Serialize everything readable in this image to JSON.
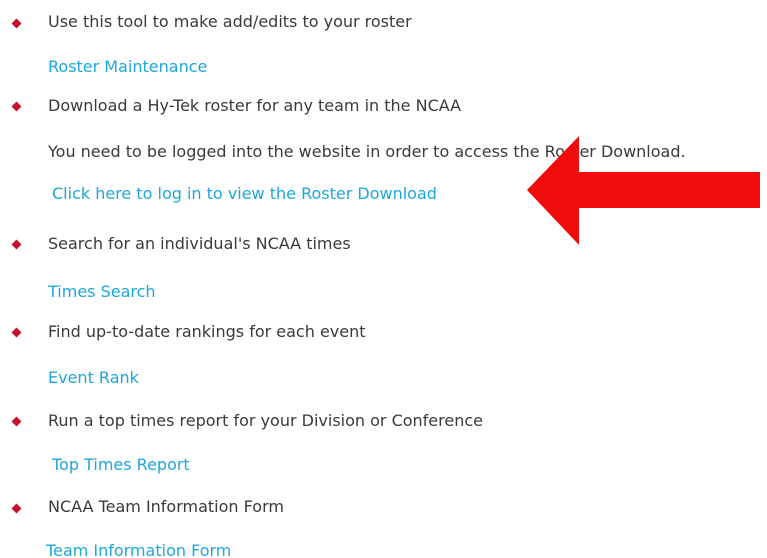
{
  "items": [
    {
      "text": "Use this tool to make add/edits to your roster",
      "link": "Roster Maintenance"
    },
    {
      "text": "Download a Hy-Tek roster for any team in the NCAA",
      "note": "You need to be logged into the website in order to access the Roster Download.",
      "link": "Click here to log in to view the Roster Download"
    },
    {
      "text": "Search for an individual's NCAA times",
      "link": "Times Search"
    },
    {
      "text": "Find up-to-date rankings for each event",
      "link": "Event Rank"
    },
    {
      "text": "Run a top times report for your Division or Conference",
      "link": "Top Times Report"
    },
    {
      "text": "NCAA Team Information Form",
      "link": "Team Information Form"
    }
  ],
  "colors": {
    "bullet": "#c8102e",
    "link": "#1ea7dc",
    "text": "#3a3a3a",
    "arrow": "#f10c0c"
  },
  "annotation": {
    "icon": "red-arrow-icon"
  }
}
